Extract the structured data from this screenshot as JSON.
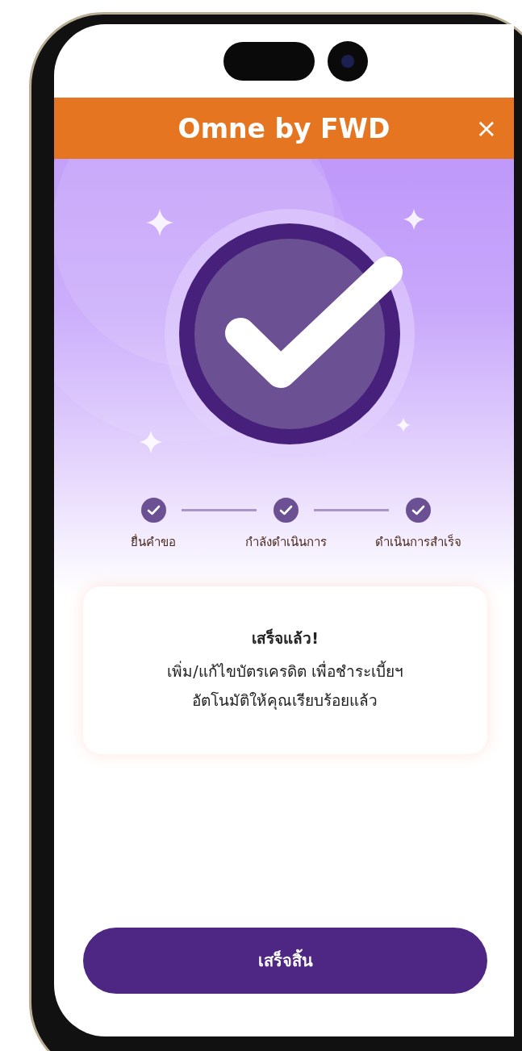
{
  "header": {
    "title": "Omne by FWD",
    "close_icon": "×"
  },
  "steps": [
    {
      "label": "ยื่นคำขอ",
      "done": true
    },
    {
      "label": "กำลังดำเนินการ",
      "done": true
    },
    {
      "label": "ดำเนินการสำเร็จ",
      "done": true
    }
  ],
  "card": {
    "title": "เสร็จแล้ว!",
    "message": "เพิ่ม/แก้ไขบัตรเครดิต เพื่อชำระเบี้ยฯ\nอัตโนมัติให้คุณเรียบร้อยแล้ว"
  },
  "button": {
    "label": "เสร็จสิ้น"
  }
}
